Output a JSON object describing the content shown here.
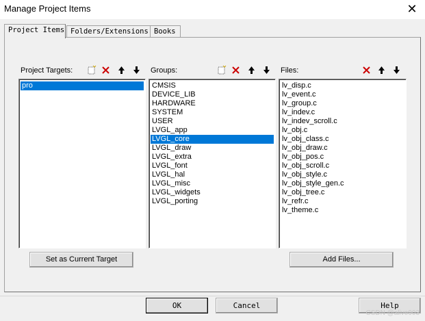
{
  "window": {
    "title": "Manage Project Items",
    "close_symbol": "✕"
  },
  "tabs": [
    {
      "label": "Project Items"
    },
    {
      "label": "Folders/Extensions"
    },
    {
      "label": "Books"
    }
  ],
  "targets": {
    "label": "Project Targets:",
    "items": [
      "pro"
    ],
    "selected": "pro",
    "set_button": "Set as Current Target"
  },
  "groups": {
    "label": "Groups:",
    "items": [
      "CMSIS",
      "DEVICE_LIB",
      "HARDWARE",
      "SYSTEM",
      "USER",
      "LVGL_app",
      "LVGL_core",
      "LVGL_draw",
      "LVGL_extra",
      "LVGL_font",
      "LVGL_hal",
      "LVGL_misc",
      "LVGL_widgets",
      "LVGL_porting"
    ],
    "selected": "LVGL_core"
  },
  "files": {
    "label": "Files:",
    "items": [
      "lv_disp.c",
      "lv_event.c",
      "lv_group.c",
      "lv_indev.c",
      "lv_indev_scroll.c",
      "lv_obj.c",
      "lv_obj_class.c",
      "lv_obj_draw.c",
      "lv_obj_pos.c",
      "lv_obj_scroll.c",
      "lv_obj_style.c",
      "lv_obj_style_gen.c",
      "lv_obj_tree.c",
      "lv_refr.c",
      "lv_theme.c"
    ],
    "add_button": "Add Files..."
  },
  "footer": {
    "ok": "OK",
    "cancel": "Cancel",
    "help": "Help",
    "watermark": "CSDN @alive903"
  },
  "colors": {
    "selection": "#0078d7",
    "delete_red": "#cc0000"
  }
}
